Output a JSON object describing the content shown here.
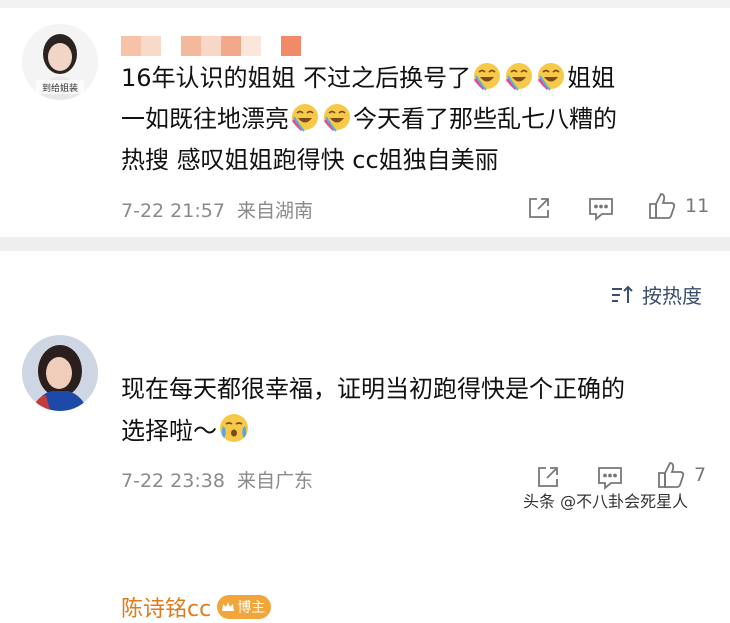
{
  "comment1": {
    "avatar_caption": "到给姐装",
    "lines": [
      "16年认识的姐姐 不过之后换号了",
      "姐姐",
      "一如既往地漂亮",
      "今天看了那些乱七八糟的",
      "热搜 感叹姐姐跑得快 cc姐独自美丽"
    ],
    "timestamp": "7-22 21:57",
    "location": "来自湖南",
    "like_count": "11"
  },
  "sort": {
    "label": "按热度"
  },
  "comment2": {
    "username": "陈诗铭cc",
    "badge": "博主",
    "line1": "现在每天都很幸福，证明当初跑得快是个正确的",
    "line2": "选择啦～",
    "timestamp": "7-22 23:38",
    "location": "来自广东",
    "like_count": "7"
  },
  "watermark": "头条 @不八卦会死星人",
  "colors": {
    "username": "#e07a1a",
    "badge": "#f2a53a",
    "meta": "#8a8a8a",
    "sort": "#3b4f6a"
  }
}
